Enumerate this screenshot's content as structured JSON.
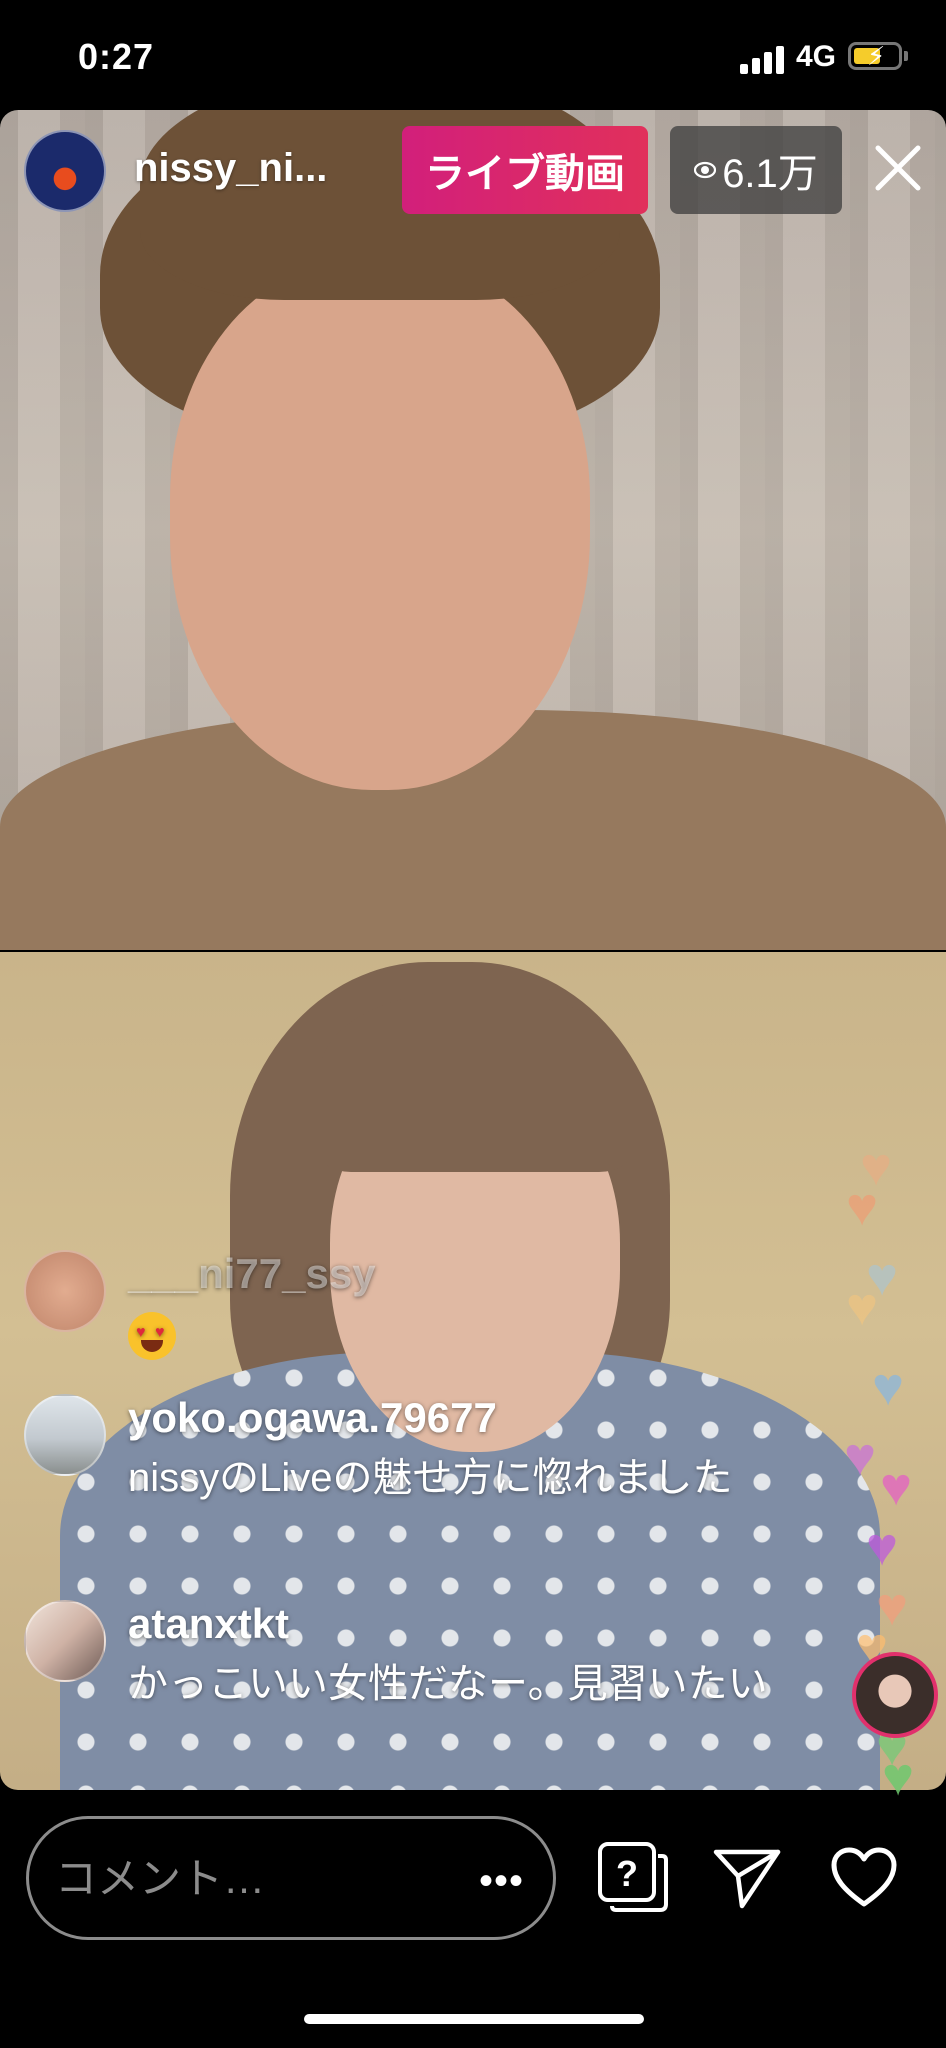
{
  "status_bar": {
    "time": "0:27",
    "network": "4G"
  },
  "live": {
    "host_username": "nissy_ni...",
    "live_label": "ライブ動画",
    "viewer_count": "6.1万"
  },
  "comments": [
    {
      "username": "___ni77_ssy",
      "text": "",
      "emoji": "heart-eyes-emoji"
    },
    {
      "username": "yoko.ogawa.79677",
      "text": "nissyのLiveの魅せ方に惚れました"
    },
    {
      "username": "atanxtkt",
      "text": "かっこいい女性だなー。見習いたい"
    }
  ],
  "comment_input": {
    "placeholder": "コメント…"
  },
  "colors": {
    "live_badge": "#d21f7b",
    "viewer_badge_bg": "#3c3c3c",
    "background": "#000000"
  },
  "icons": [
    "eye-icon",
    "close-icon",
    "more-icon",
    "question-icon",
    "send-icon",
    "heart-icon"
  ]
}
